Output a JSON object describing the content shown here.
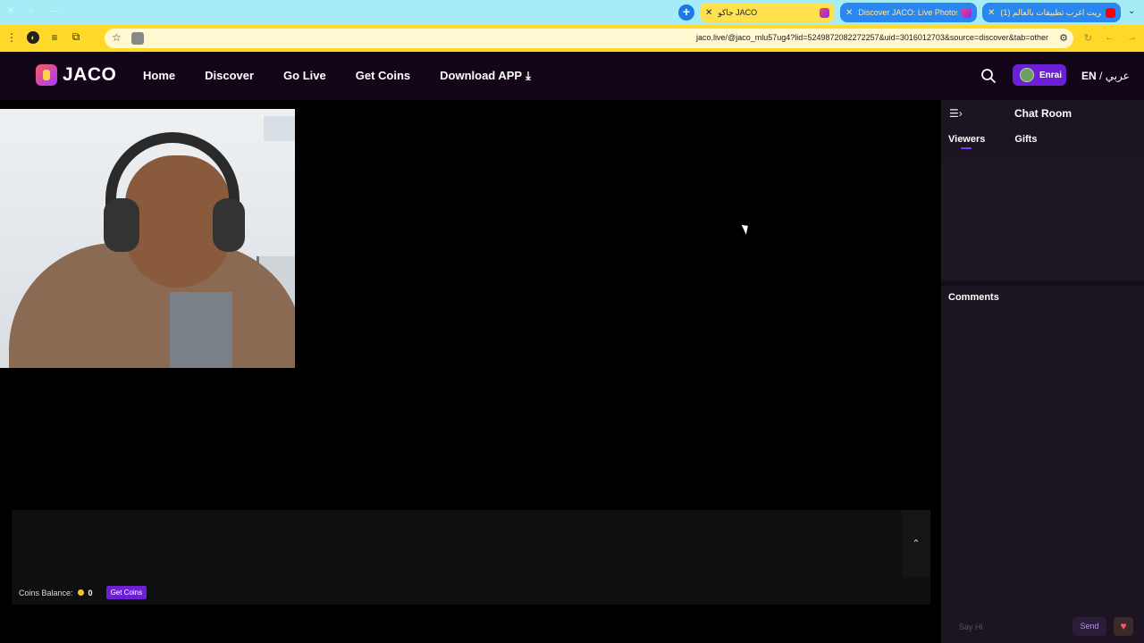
{
  "browser": {
    "tabs": [
      {
        "title": "جاكو JACO",
        "active": true
      },
      {
        "title": "Discover JACO: Live Photos, Vi",
        "active": false
      },
      {
        "title": "(1) حريت اغرب تطبيقات بالعالم",
        "active": false
      }
    ],
    "url": "jaco.live/@jaco_mlu57ug4?lid=5249872082272257&uid=3016012703&source=discover&tab=other"
  },
  "site": {
    "logo_text": "JACO",
    "nav": {
      "home": "Home",
      "discover": "Discover",
      "go_live": "Go Live",
      "get_coins": "Get Coins",
      "download_app": "Download APP"
    },
    "user_name": "Enrai",
    "lang_en": "EN",
    "lang_sep": " / ",
    "lang_ar": "عربي"
  },
  "stream": {
    "coins_balance_label": "Coins Balance:",
    "coins_balance_value": "0",
    "get_coins_button": "Get Coins"
  },
  "chat": {
    "title": "Chat Room",
    "tabs": {
      "viewers": "Viewers",
      "gifts": "Gifts"
    },
    "comments_title": "Comments",
    "input_placeholder": "Say Hi",
    "send_label": "Send"
  },
  "colors": {
    "accent": "#6d1fd6",
    "header_bg": "#120618",
    "chat_bg": "#1c1521"
  }
}
